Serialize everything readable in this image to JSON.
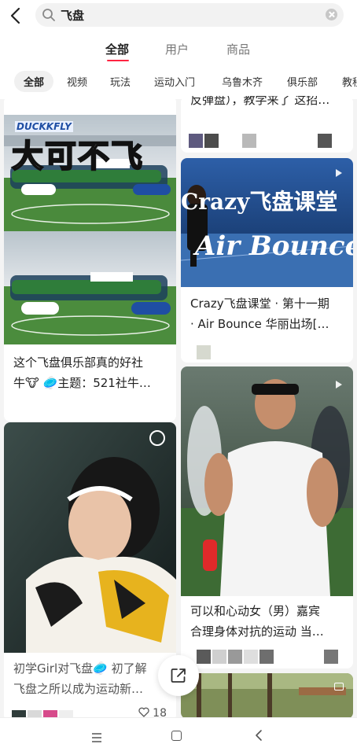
{
  "search": {
    "query": "飞盘"
  },
  "main_tabs": [
    "全部",
    "用户",
    "商品"
  ],
  "filter_chips": [
    "全部",
    "视频",
    "玩法",
    "运动入门",
    "乌鲁木齐",
    "俱乐部",
    "教程"
  ],
  "cards": [
    {
      "title_line1": "反弹盘），教学来了 这招…"
    },
    {
      "overlay_logo": "DUCKKFLY",
      "overlay_text": "大可不飞",
      "title_line1": "这个飞盘俱乐部真的好社",
      "title_line2": "牛🐮 🥏主题：521社牛…"
    },
    {
      "cover_line1": "Crazy飞盘课堂",
      "cover_line2": "Air Bounce",
      "title_line1": "Crazy飞盘课堂 · 第十一期",
      "title_line2": "· Air Bounce 华丽出场[…"
    },
    {
      "title_line1": "初学Girl对飞盘🥏 初了解",
      "title_line2": "飞盘之所以成为运动新…",
      "likes": "18"
    },
    {
      "title_line1": "可以和心动女（男）嘉宾",
      "title_line2": "合理身体对抗的运动 当…"
    }
  ]
}
